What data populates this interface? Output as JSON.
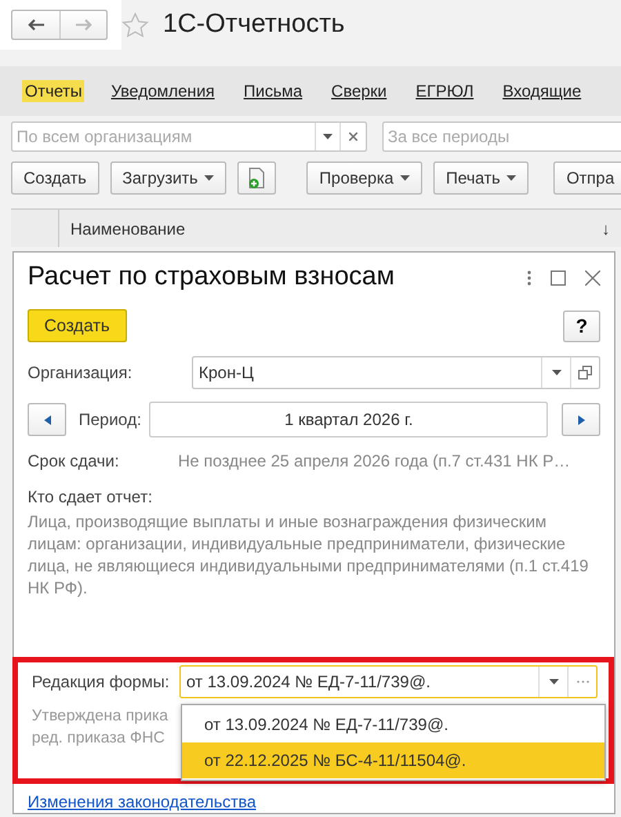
{
  "window": {
    "title": "1С-Отчетность"
  },
  "tabs": [
    {
      "label": "Отчеты",
      "selected": true
    },
    {
      "label": "Уведомления",
      "selected": false
    },
    {
      "label": "Письма",
      "selected": false
    },
    {
      "label": "Сверки",
      "selected": false
    },
    {
      "label": "ЕГРЮЛ",
      "selected": false
    },
    {
      "label": "Входящие",
      "selected": false
    }
  ],
  "filters": [
    {
      "placeholder": "По всем организациям"
    },
    {
      "placeholder": "За все периоды"
    }
  ],
  "toolbar": [
    {
      "kind": "button",
      "label": "Создать"
    },
    {
      "kind": "menu",
      "label": "Загрузить"
    },
    {
      "kind": "icon"
    },
    {
      "kind": "menu",
      "label": "Проверка"
    },
    {
      "kind": "menu",
      "label": "Печать"
    },
    {
      "kind": "button",
      "label": "Отпра"
    }
  ],
  "table": {
    "columns": [
      "Наименование"
    ],
    "sort_mark": "↓"
  },
  "dialog": {
    "title": "Расчет по страховым взносам",
    "create_button": "Создать",
    "help_button": "?",
    "organization": {
      "label": "Организация:",
      "value": "Крон-Ц"
    },
    "period": {
      "label": "Период:",
      "value": "1 квартал 2026 г."
    },
    "deadline": {
      "label": "Срок сдачи:",
      "value": "Не позднее 25 апреля 2026 года (п.7 ст.431 НК Р…"
    },
    "who": {
      "label": "Кто сдает отчет:",
      "text": "Лица, производящие выплаты и иные вознаграждения физическим лицам: организации, индивидуальные предприниматели, физические лица, не являющиеся индивидуальными предпринимателями (п.1 ст.419 НК РФ)."
    },
    "edition": {
      "label": "Редакция формы:",
      "value": "от 13.09.2024 № ЕД-7-11/739@.",
      "approved_lines": [
        "Утверждена прика",
        "ред. приказа ФНС"
      ],
      "options": [
        {
          "label": "от 13.09.2024 № ЕД-7-11/739@.",
          "highlighted": false
        },
        {
          "label": "от 22.12.2025 № БС-4-11/11504@.",
          "highlighted": true
        }
      ]
    },
    "link": "Изменения законодательства"
  }
}
